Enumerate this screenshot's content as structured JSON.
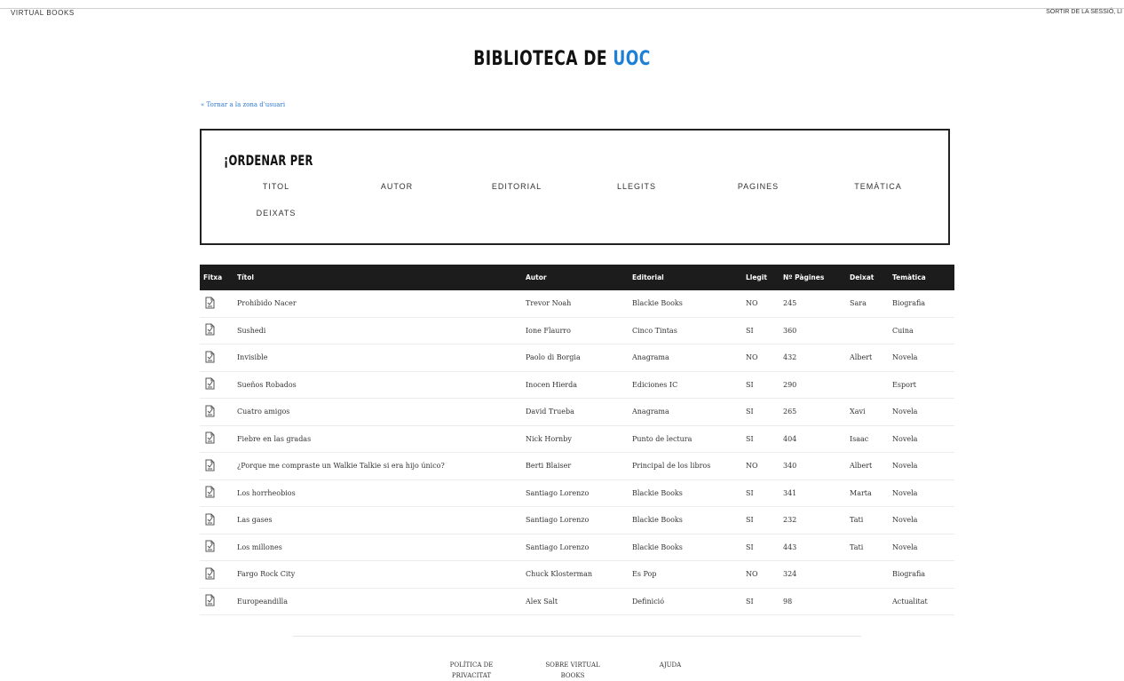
{
  "header": {
    "brand": "VIRTUAL BOOKS",
    "logout": "SORTIR DE LA SESSIÓ, LI"
  },
  "title": {
    "prefix": "BIBLIOTECA DE ",
    "accent": "UOC"
  },
  "back_link": "« Tornar a la zona d'usuari",
  "sort": {
    "title": "¡ORDENAR PER",
    "options": [
      "TITOL",
      "AUTOR",
      "EDITORIAL",
      "LLEGITS",
      "PAGINES",
      "TEMÀTICA",
      "DEIXATS"
    ]
  },
  "table": {
    "headers": [
      "Fitxa",
      "Títol",
      "Autor",
      "Editorial",
      "Llegit",
      "Nº Pàgines",
      "Deixat",
      "Temàtica"
    ],
    "rows": [
      [
        "",
        "Prohibido Nacer",
        "Trevor Noah",
        "Blackie Books",
        "NO",
        "245",
        "Sara",
        "Biografia"
      ],
      [
        "",
        "Sushedi",
        "Ione Flaurro",
        "Cinco Tintas",
        "SI",
        "360",
        "",
        "Cuina"
      ],
      [
        "",
        "Invisible",
        "Paolo di Borgia",
        "Anagrama",
        "NO",
        "432",
        "Albert",
        "Novela"
      ],
      [
        "",
        "Sueños Robados",
        "Inocen Hierda",
        "Ediciones IC",
        "SI",
        "290",
        "",
        "Esport"
      ],
      [
        "",
        "Cuatro amigos",
        "David Trueba",
        "Anagrama",
        "SI",
        "265",
        "Xavi",
        "Novela"
      ],
      [
        "",
        "Fiebre en las gradas",
        "Nick Hornby",
        "Punto de lectura",
        "SI",
        "404",
        "Isaac",
        "Novela"
      ],
      [
        "",
        "¿Porque me compraste un Walkie Talkie si era hijo único?",
        "Berti Blaiser",
        "Principal de los libros",
        "NO",
        "340",
        "Albert",
        "Novela"
      ],
      [
        "",
        "Los horrheobios",
        "Santiago Lorenzo",
        "Blackie Books",
        "SI",
        "341",
        "Marta",
        "Novela"
      ],
      [
        "",
        "Las gases",
        "Santiago Lorenzo",
        "Blackie Books",
        "SI",
        "232",
        "Tati",
        "Novela"
      ],
      [
        "",
        "Los millones",
        "Santiago Lorenzo",
        "Blackie Books",
        "SI",
        "443",
        "Tati",
        "Novela"
      ],
      [
        "",
        "Fargo Rock City",
        "Chuck Klosterman",
        "Es Pop",
        "NO",
        "324",
        "",
        "Biografia"
      ],
      [
        "",
        "Europeandilla",
        "Alex Salt",
        "Definició",
        "SI",
        "98",
        "",
        "Actualitat"
      ]
    ]
  },
  "footer": {
    "links": [
      [
        "POLÍTICA DE",
        "PRIVACITAT"
      ],
      [
        "SOBRE VIRTUAL",
        "BOOKS"
      ],
      [
        "AJUDA"
      ]
    ]
  }
}
